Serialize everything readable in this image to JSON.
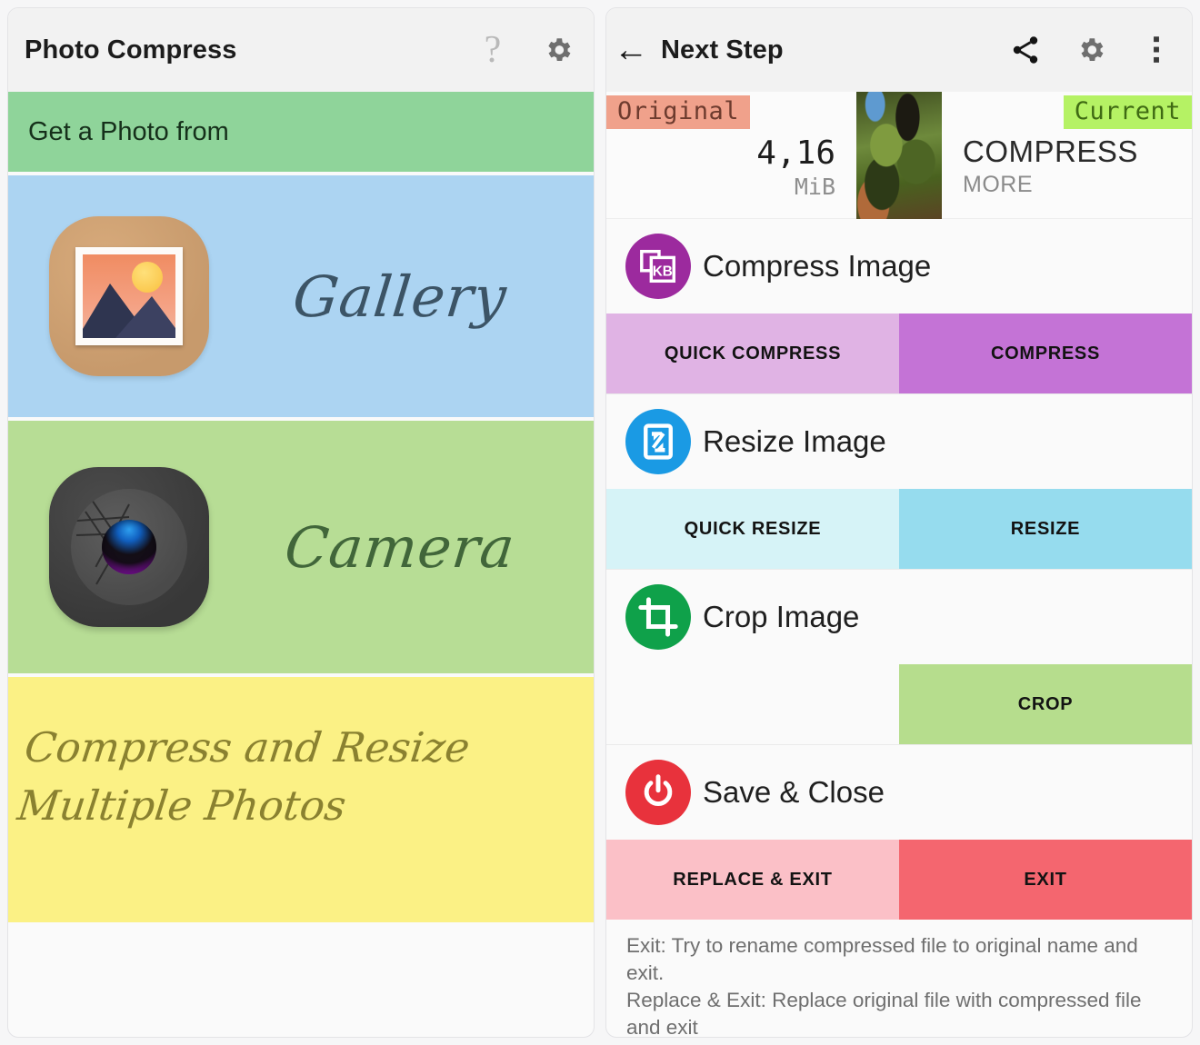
{
  "left_panel": {
    "appbar": {
      "title": "Photo Compress",
      "help_icon": "question-mark-icon",
      "settings_icon": "gear-icon"
    },
    "header_band": {
      "label": "Get a Photo from"
    },
    "sources": [
      {
        "label": "Gallery",
        "icon": "gallery-photo-icon",
        "bg": "#acd4f2",
        "text_color": "#3c5466"
      },
      {
        "label": "Camera",
        "icon": "camera-aperture-icon",
        "bg": "#b7dd95",
        "text_color": "#41663a"
      }
    ],
    "promo": {
      "text": "Compress and Resize Multiple Photos",
      "bg": "#fbf185",
      "text_color": "#8a8130"
    }
  },
  "right_panel": {
    "appbar": {
      "back_icon": "back-arrow-icon",
      "title": "Next Step",
      "share_icon": "share-icon",
      "settings_icon": "gear-icon",
      "overflow_icon": "more-vertical-icon"
    },
    "summary": {
      "original_label": "Original",
      "original_size": "4,16",
      "original_unit": "MiB",
      "thumbnail": "image-thumbnail",
      "current_label": "Current",
      "current_line1": "COMPRESS",
      "current_line2": "MORE",
      "original_pill_bg": "#f0a18b",
      "current_pill_bg": "#b5f264"
    },
    "actions": [
      {
        "title": "Compress Image",
        "icon": "compress-kb-icon",
        "icon_bg": "#9c2a9e",
        "buttons": [
          {
            "label": "QUICK COMPRESS",
            "bg": "#e0b3e4"
          },
          {
            "label": "COMPRESS",
            "bg": "#c473d6"
          }
        ]
      },
      {
        "title": "Resize Image",
        "icon": "resize-arrows-icon",
        "icon_bg": "#1a9ae4",
        "buttons": [
          {
            "label": "QUICK RESIZE",
            "bg": "#d6f3f7"
          },
          {
            "label": "RESIZE",
            "bg": "#96dcee"
          }
        ]
      },
      {
        "title": "Crop Image",
        "icon": "crop-icon",
        "icon_bg": "#0fa14a",
        "buttons": [
          {
            "label": "",
            "bg": "#fafafa"
          },
          {
            "label": "CROP",
            "bg": "#b6dd8d"
          }
        ]
      },
      {
        "title": "Save & Close",
        "icon": "power-icon",
        "icon_bg": "#e8323c",
        "buttons": [
          {
            "label": "REPLACE & EXIT",
            "bg": "#fbc0c7"
          },
          {
            "label": "EXIT",
            "bg": "#f4666f"
          }
        ]
      }
    ],
    "footnote": "Exit: Try to rename compressed file to original name and exit.\nReplace & Exit: Replace original file with compressed file and exit"
  }
}
